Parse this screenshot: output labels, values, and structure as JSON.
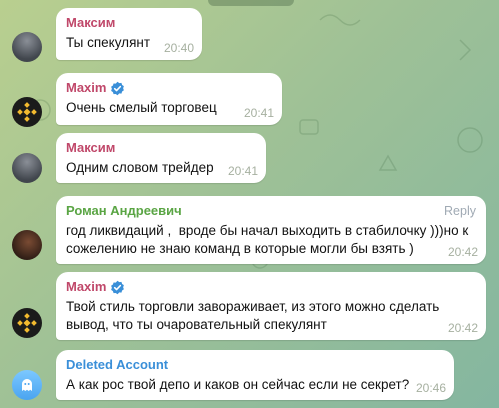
{
  "messages": [
    {
      "sender": "Максим",
      "text": "Ты спекулянт",
      "time": "20:40",
      "sender_color": "#c0486a"
    },
    {
      "sender": "Maxim",
      "text": "Очень смелый торговец",
      "time": "20:41",
      "sender_color": "#c0486a"
    },
    {
      "sender": "Максим",
      "text": "Одним словом трейдер",
      "time": "20:41",
      "sender_color": "#c0486a"
    },
    {
      "sender": "Роман Андреевич",
      "reply_label": "Reply",
      "text": "год ликвидаций ,  вроде бы начал выходить в стабилочку )))но к\nсожелению не знаю команд в которые могли бы взять )",
      "time": "20:42",
      "sender_color": "#5aa544"
    },
    {
      "sender": "Maxim",
      "text": "Твой стиль торговли завораживает, из этого можно сделать\nвывод, что ты очаровательный спекулянт",
      "time": "20:42",
      "sender_color": "#c0486a"
    },
    {
      "sender": "Deleted Account",
      "text": "А как рос твой депо и каков он сейчас если не секрет?",
      "time": "20:46",
      "sender_color": "#3a8fd8"
    }
  ],
  "icons": {
    "verified": "verified-badge-icon",
    "binance": "binance-logo-icon",
    "ghost": "ghost-icon"
  },
  "colors": {
    "bubble": "#ffffff",
    "verified": "#3a8fd8",
    "binance": "#f3ba2f"
  }
}
